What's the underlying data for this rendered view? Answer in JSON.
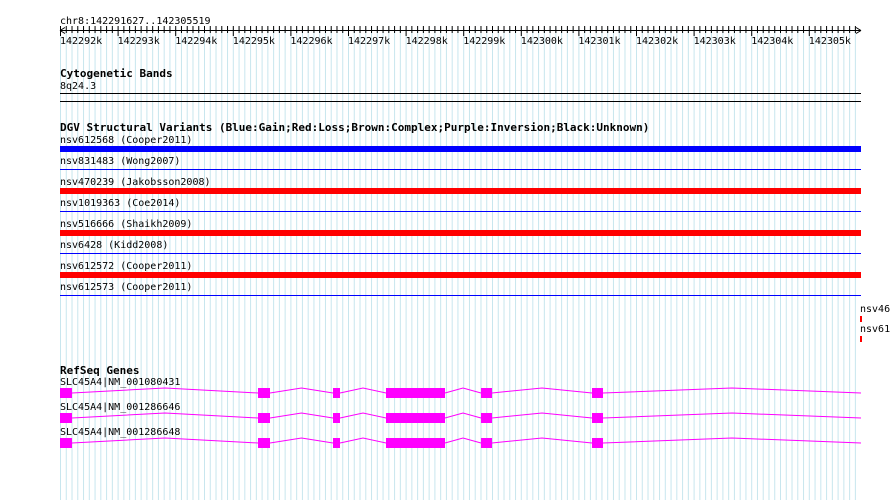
{
  "ruler": {
    "location": "chr8:142291627..142305519",
    "ticks": [
      "142292k",
      "142293k",
      "142294k",
      "142295k",
      "142296k",
      "142297k",
      "142298k",
      "142299k",
      "142300k",
      "142301k",
      "142302k",
      "142303k",
      "142304k",
      "142305k"
    ]
  },
  "cytoband": {
    "title": "Cytogenetic Bands",
    "band": "8q24.3"
  },
  "dgv": {
    "title": "DGV Structural Variants (Blue:Gain;Red:Loss;Brown:Complex;Purple:Inversion;Black:Unknown)",
    "colors": {
      "gain": "#0000ff",
      "loss": "#ff0000"
    },
    "variants": [
      {
        "label": "nsv612568 (Cooper2011)",
        "type": "gain"
      },
      {
        "label": "nsv831483 (Wong2007)",
        "type": "gain"
      },
      {
        "label": "nsv470239 (Jakobsson2008)",
        "type": "loss"
      },
      {
        "label": "nsv1019363 (Coe2014)",
        "type": "gain"
      },
      {
        "label": "nsv516666 (Shaikh2009)",
        "type": "loss"
      },
      {
        "label": "nsv6428 (Kidd2008)",
        "type": "gain"
      },
      {
        "label": "nsv612572 (Cooper2011)",
        "type": "loss"
      },
      {
        "label": "nsv612573 (Cooper2011)",
        "type": "gain"
      }
    ],
    "offscreen": [
      {
        "label": "nsv46"
      },
      {
        "label": "nsv61"
      }
    ]
  },
  "refseq": {
    "title": "RefSeq Genes",
    "color": "#ff00ff",
    "genes": [
      {
        "label": "SLC45A4|NM_001080431"
      },
      {
        "label": "SLC45A4|NM_001286646"
      },
      {
        "label": "SLC45A4|NM_001286648"
      }
    ]
  }
}
